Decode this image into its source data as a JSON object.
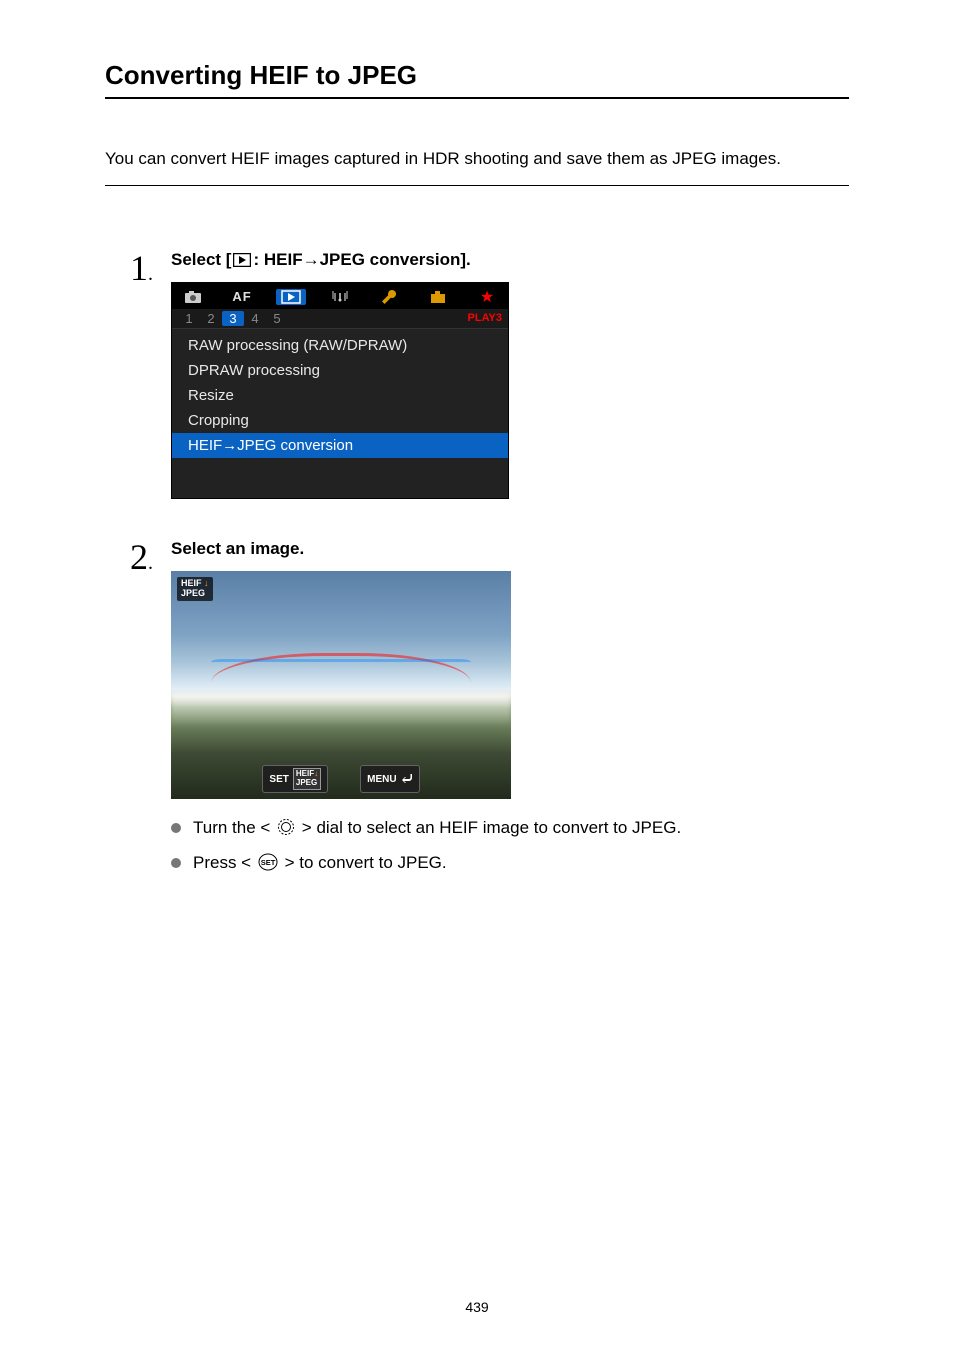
{
  "page_title": "Converting HEIF to JPEG",
  "intro": "You can convert HEIF images captured in HDR shooting and save them as JPEG images.",
  "steps": {
    "step1": {
      "number": "1",
      "heading_pre": "Select [",
      "heading_post": ": HEIF→JPEG conversion].",
      "menu": {
        "tabs": {
          "af": "AF"
        },
        "sub_tabs": [
          "1",
          "2",
          "3",
          "4",
          "5"
        ],
        "section_label": "PLAY3",
        "items": [
          "RAW processing (RAW/DPRAW)",
          "DPRAW processing",
          "Resize",
          "Cropping",
          "HEIF→JPEG conversion"
        ]
      }
    },
    "step2": {
      "number": "2",
      "heading": "Select an image.",
      "image_overlay": {
        "badge_line1": "HEIF",
        "badge_line2": "JPEG",
        "set_btn": "SET",
        "set_badge_l1": "HEIF",
        "set_badge_l2": "JPEG",
        "menu_btn": "MENU"
      },
      "bullets": {
        "b1_pre": "Turn the < ",
        "b1_post": " > dial to select an HEIF image to convert to JPEG.",
        "b2_pre": "Press < ",
        "b2_post": " > to convert to JPEG."
      }
    }
  },
  "page_number": "439"
}
